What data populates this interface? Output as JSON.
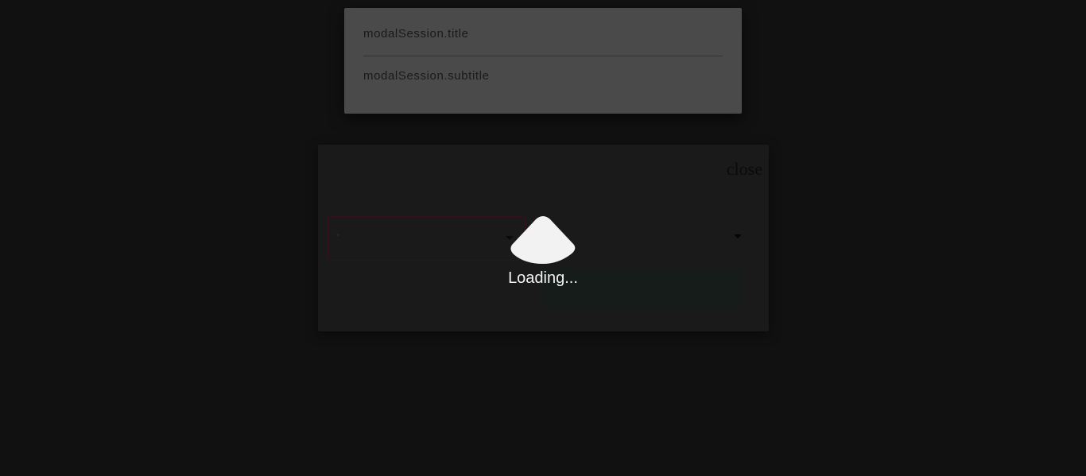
{
  "session_card": {
    "title": "modalSession.title",
    "subtitle": "modalSession.subtitle"
  },
  "dialog": {
    "close_label": "close",
    "left_select": {
      "required_mark": "*",
      "icon": "chevron-down-icon"
    },
    "right_select": {
      "icon": "chevron-down-icon"
    }
  },
  "loading": {
    "text": "Loading...",
    "icon": "spinner-icon"
  },
  "colors": {
    "background": "#111111",
    "card": "#4a4a4a",
    "dialog": "#1a1a1a",
    "select_border": "#3a0f1c",
    "spinner": "#f2f2f2"
  }
}
